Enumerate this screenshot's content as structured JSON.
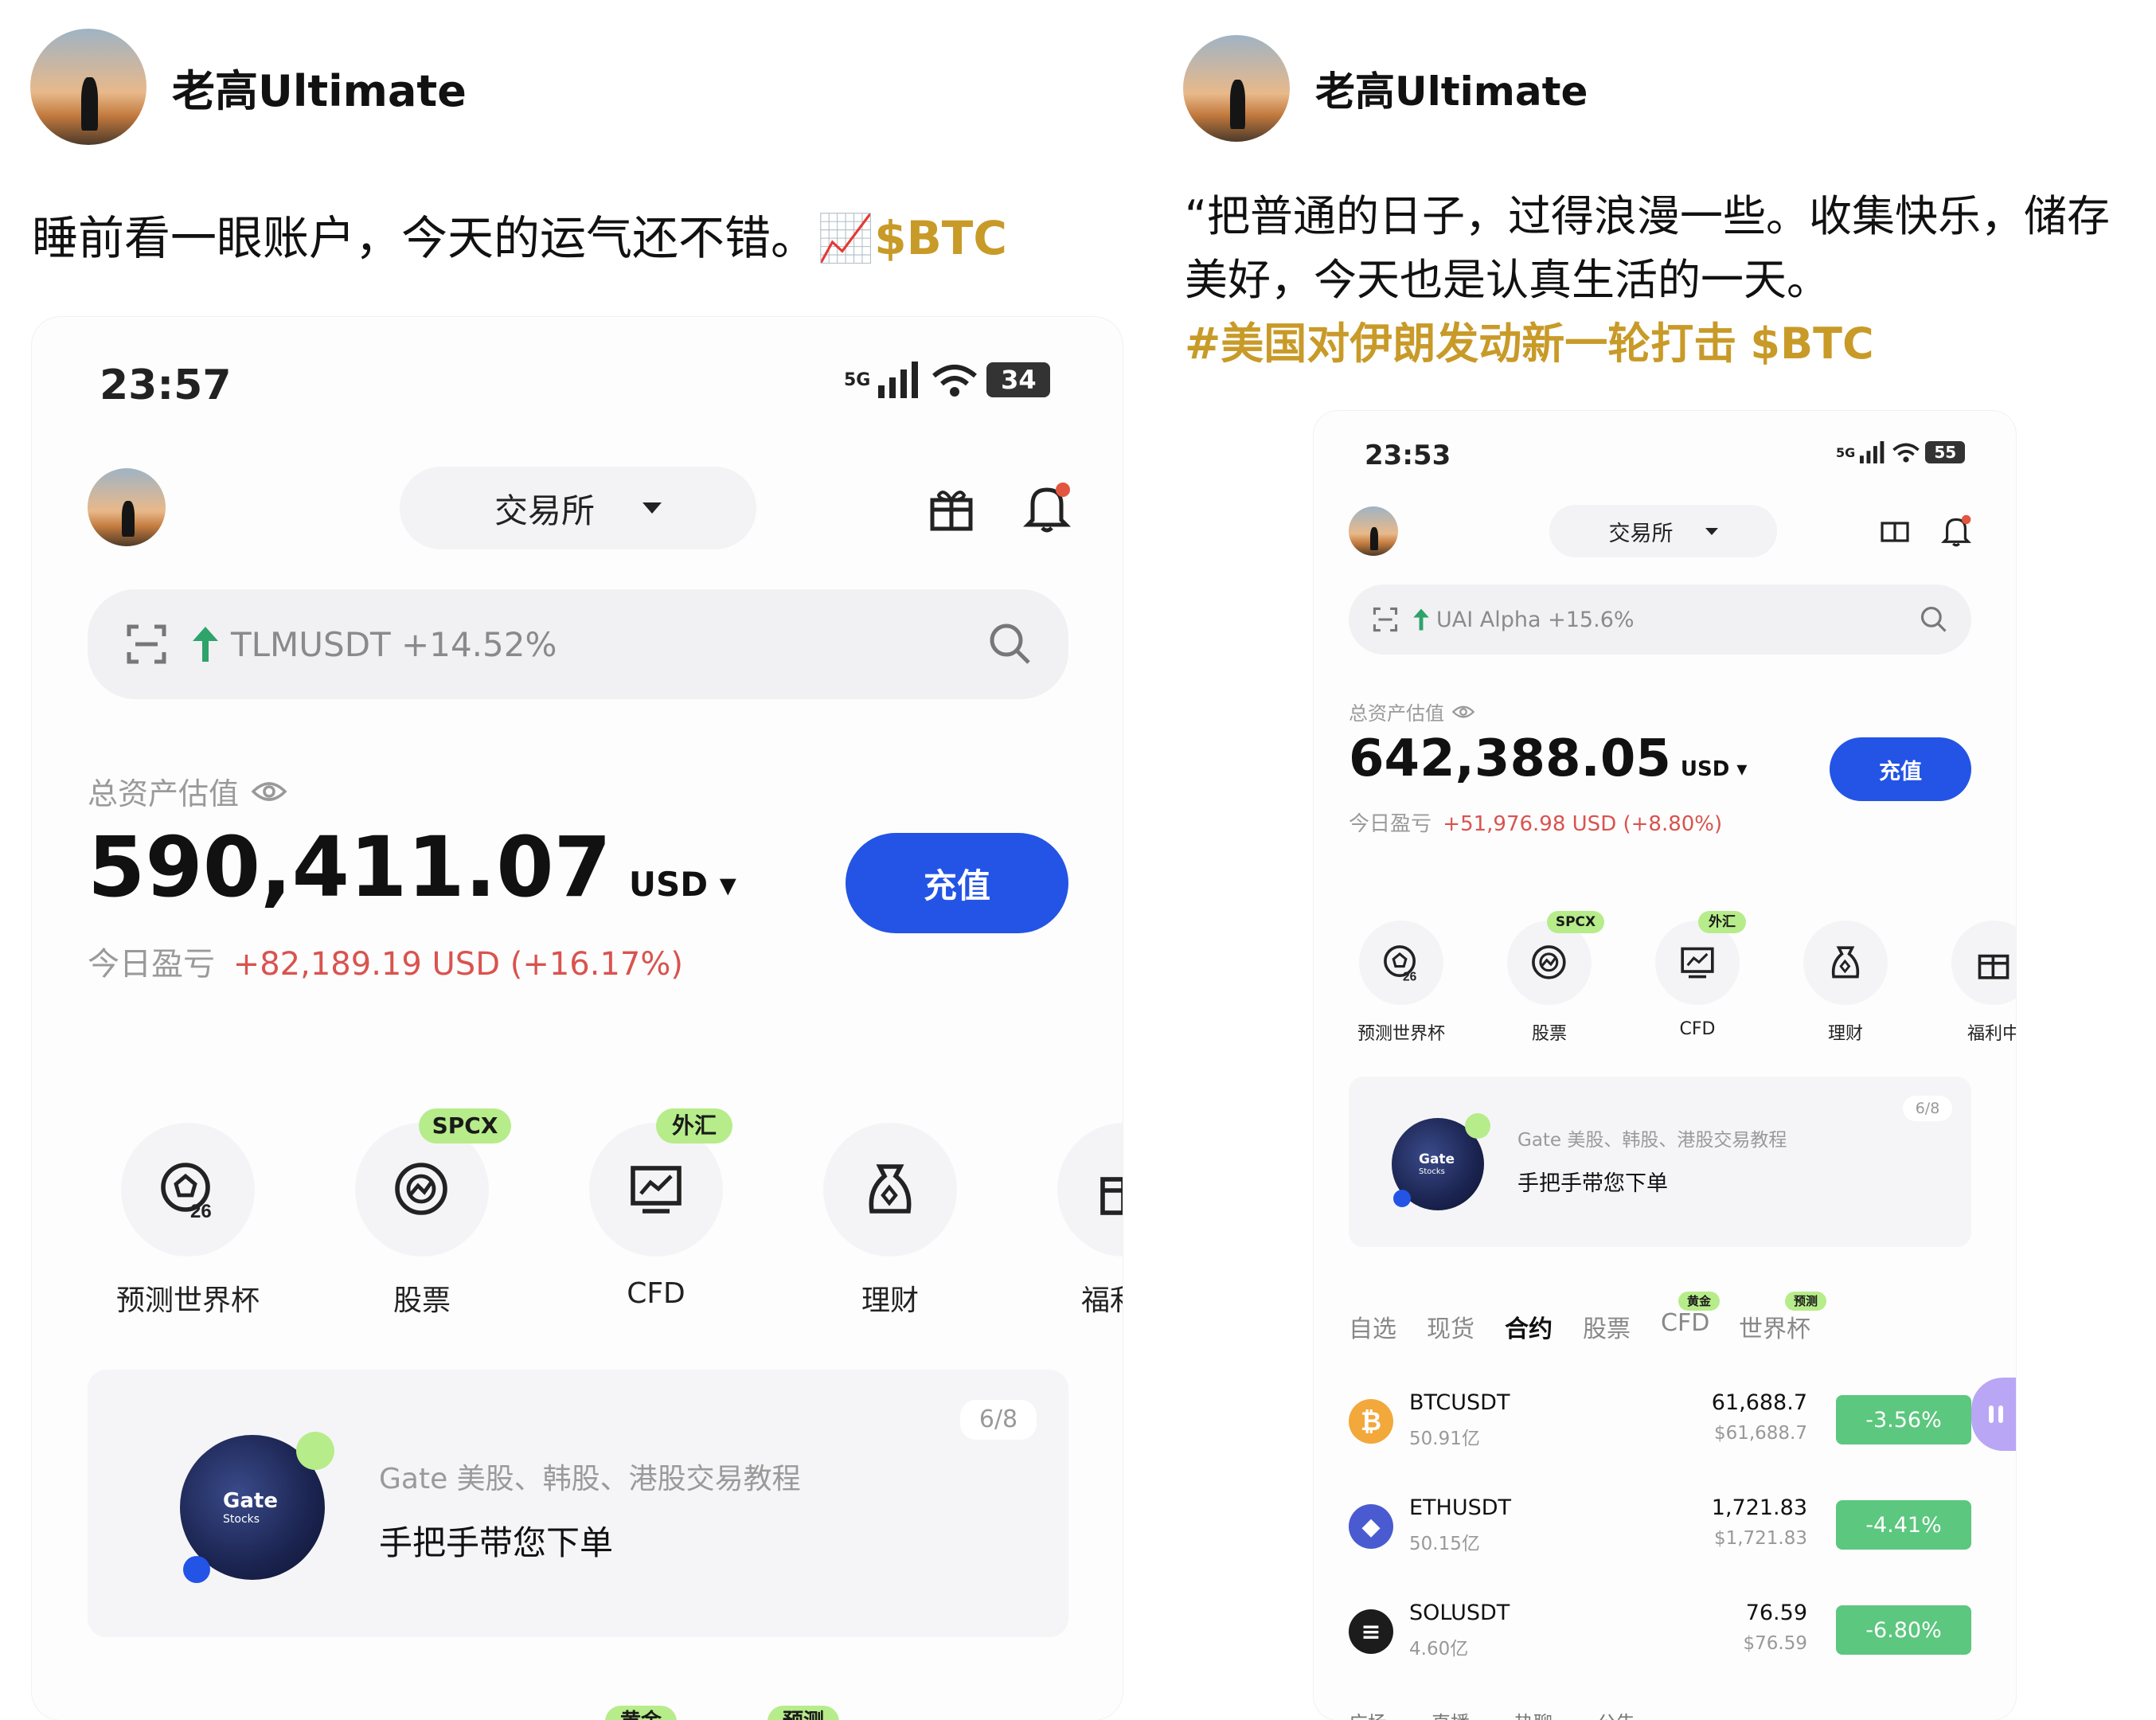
{
  "left_post": {
    "author": "老高Ultimate",
    "text": "睡前看一眼账户，今天的运气还不错。",
    "chart_emoji": "📈",
    "ticker": "$BTC",
    "phone": {
      "status": {
        "time": "23:57",
        "network": "5G",
        "battery": "34"
      },
      "exchange_label": "交易所",
      "search": {
        "ticker": "TLMUSDT +14.52%"
      },
      "asset_label": "总资产估值",
      "balance": "590,411.07",
      "currency": "USD",
      "pnl_label": "今日盈亏",
      "pnl_value": "+82,189.19 USD (+16.17%)",
      "deposit_label": "充值",
      "quick": [
        {
          "label": "预测世界杯",
          "icon": "worldcup-icon",
          "badge": ""
        },
        {
          "label": "股票",
          "icon": "stocks-icon",
          "badge": "SPCX"
        },
        {
          "label": "CFD",
          "icon": "cfd-chart-icon",
          "badge": "外汇"
        },
        {
          "label": "理财",
          "icon": "wealth-bag-icon",
          "badge": ""
        },
        {
          "label": "福利中",
          "icon": "gift-icon",
          "badge": ""
        }
      ],
      "banner": {
        "subtitle": "Gate 美股、韩股、港股交易教程",
        "title": "手把手带您下单",
        "page": "6/8",
        "art_text": "Gate",
        "art_sub": "Stocks"
      },
      "bottom_badges": [
        "黄金",
        "预测"
      ]
    }
  },
  "right_post": {
    "author": "老高Ultimate",
    "text_line1": "“把普通的日子，过得浪漫一些。收集快乐，储存",
    "text_line2": "美好，今天也是认真生活的一天。",
    "hashtag": "#美国对伊朗发动新一轮打击",
    "ticker": "$BTC",
    "phone": {
      "status": {
        "time": "23:53",
        "network": "5G",
        "battery": "55"
      },
      "exchange_label": "交易所",
      "search": {
        "ticker": "UAI Alpha +15.6%"
      },
      "asset_label": "总资产估值",
      "balance": "642,388.05",
      "currency": "USD",
      "pnl_label": "今日盈亏",
      "pnl_value": "+51,976.98 USD (+8.80%)",
      "deposit_label": "充值",
      "quick": [
        {
          "label": "预测世界杯",
          "icon": "worldcup-icon",
          "badge": ""
        },
        {
          "label": "股票",
          "icon": "stocks-icon",
          "badge": "SPCX"
        },
        {
          "label": "CFD",
          "icon": "cfd-chart-icon",
          "badge": "外汇"
        },
        {
          "label": "理财",
          "icon": "wealth-bag-icon",
          "badge": ""
        },
        {
          "label": "福利中",
          "icon": "gift-icon",
          "badge": ""
        }
      ],
      "banner": {
        "subtitle": "Gate 美股、韩股、港股交易教程",
        "title": "手把手带您下单",
        "page": "6/8",
        "art_text": "Gate",
        "art_sub": "Stocks"
      },
      "market_tabs": [
        {
          "label": "自选",
          "badge": "",
          "active": false
        },
        {
          "label": "现货",
          "badge": "",
          "active": false
        },
        {
          "label": "合约",
          "badge": "",
          "active": true
        },
        {
          "label": "股票",
          "badge": "",
          "active": false
        },
        {
          "label": "CFD",
          "badge": "黄金",
          "active": false
        },
        {
          "label": "世界杯",
          "badge": "预测",
          "active": false
        }
      ],
      "markets": [
        {
          "symbol": "BTCUSDT",
          "volume": "50.91亿",
          "price": "61,688.7",
          "fiat": "$61,688.7",
          "change": "-3.56%",
          "coin_color": "#f2a83b",
          "coin_glyph": "₿"
        },
        {
          "symbol": "ETHUSDT",
          "volume": "50.15亿",
          "price": "1,721.83",
          "fiat": "$1,721.83",
          "change": "-4.41%",
          "coin_color": "#4a5bd1",
          "coin_glyph": "◆"
        },
        {
          "symbol": "SOLUSDT",
          "volume": "4.60亿",
          "price": "76.59",
          "fiat": "$76.59",
          "change": "-6.80%",
          "coin_color": "#1c1c1c",
          "coin_glyph": "≡"
        }
      ],
      "bottom_tabs": [
        "广场",
        "直播",
        "热聊",
        "公告"
      ]
    }
  },
  "colors": {
    "accent_blue": "#2354e6",
    "ticker_gold": "#c89a28",
    "gain_red": "#d9534f",
    "change_green": "#5cc77e",
    "badge_green": "#b7ec8a"
  }
}
